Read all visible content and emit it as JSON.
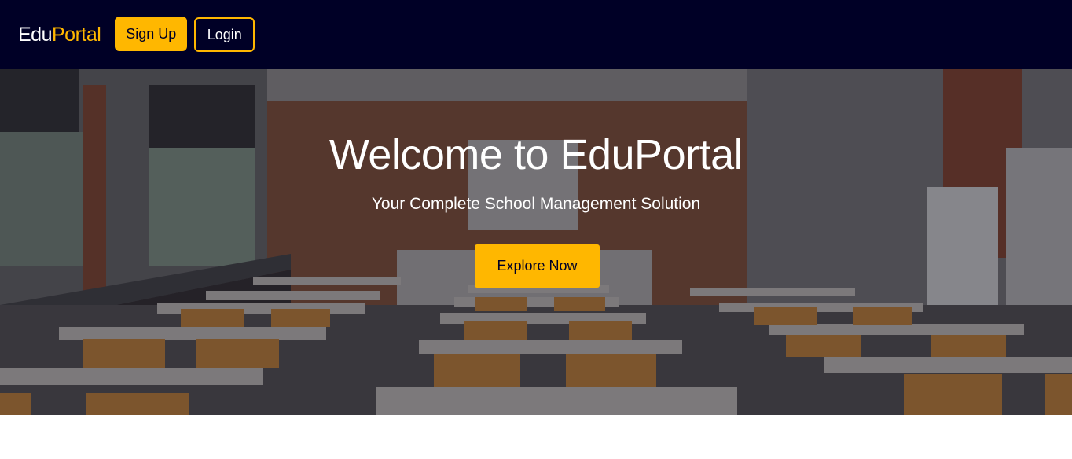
{
  "navbar": {
    "logo_primary": "Edu",
    "logo_accent": "Portal",
    "signup_label": "Sign Up",
    "login_label": "Login"
  },
  "hero": {
    "title": "Welcome to EduPortal",
    "subtitle": "Your Complete School Management Solution",
    "cta_label": "Explore Now",
    "background_image": "classroom-photo"
  },
  "colors": {
    "navbar_bg": "#000026",
    "accent": "#ffb700",
    "text_light": "#ffffff"
  }
}
